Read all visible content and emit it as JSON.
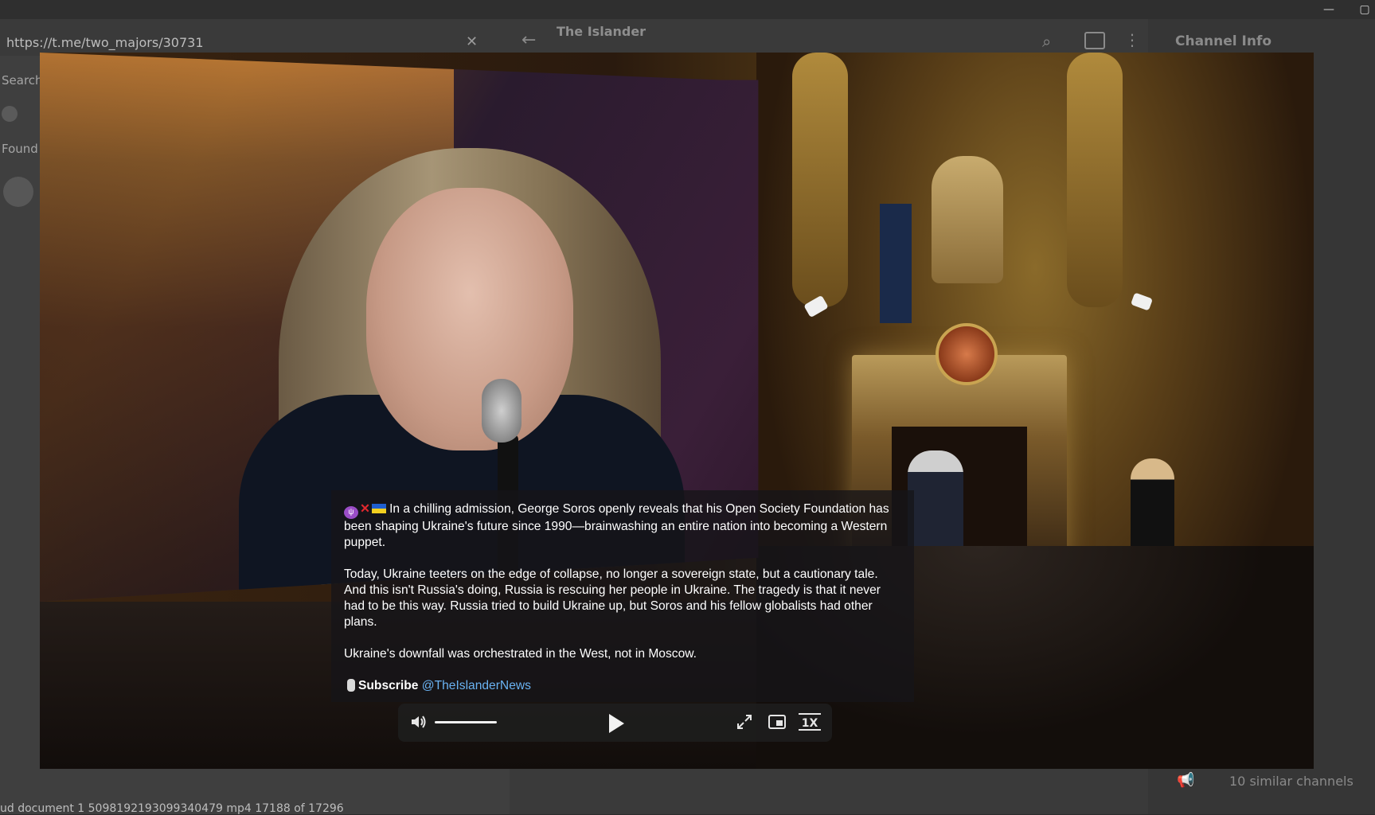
{
  "window": {
    "minimize_label": "—",
    "maximize_label": "▢"
  },
  "urlbar": {
    "value": "https://t.me/two_majors/30731",
    "close_label": "✕"
  },
  "left_panel": {
    "search_label": "Search",
    "found_label": "Found"
  },
  "chat_header": {
    "title": "The Islander"
  },
  "right_panel": {
    "title": "Channel Info",
    "similar_channels": "10 similar channels"
  },
  "status_bar": {
    "text": "ud document 1 5098192193099340479 mp4 17188 of 17296"
  },
  "caption": {
    "paragraph1": "In a chilling admission, George Soros openly reveals that his Open Society Foundation has been shaping Ukraine's future since 1990—brainwashing an entire nation into becoming a Western puppet.",
    "paragraph2": "Today, Ukraine teeters on the edge of collapse, no longer a sovereign state, but a cautionary tale. And this isn't Russia's doing, Russia is rescuing her people in Ukraine. The tragedy is that it never had to be this way. Russia tried to build Ukraine up, but Soros and his fellow globalists had other plans.",
    "paragraph3": "Ukraine's downfall was orchestrated in the West, not in Moscow.",
    "subscribe_label": "Subscribe",
    "handle": "@TheIslanderNews",
    "emoji_x": "✕"
  },
  "player": {
    "speed_label": "1X",
    "volume_level": 0.75,
    "icons": [
      "volume-icon",
      "play-icon",
      "fullscreen-icon",
      "picture-in-picture-icon"
    ]
  },
  "colors": {
    "link": "#6ab3f3",
    "caption_bg": "#161418",
    "controls_bg": "#1e1e1e"
  }
}
